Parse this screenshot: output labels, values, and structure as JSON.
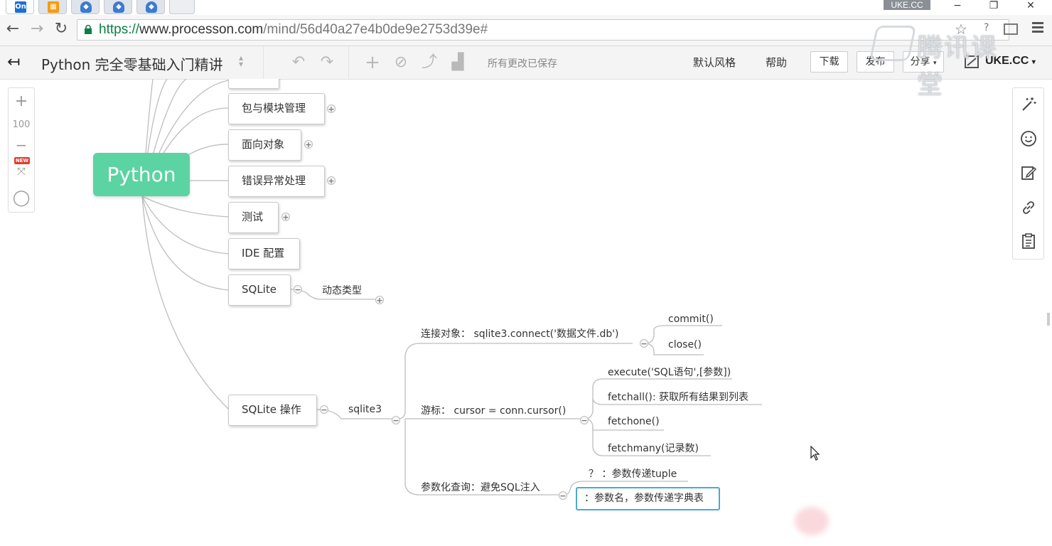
{
  "browser": {
    "tabs": [
      {
        "icon": "on-logo-icon",
        "active": true,
        "label": "On"
      },
      {
        "icon": "orange-app-icon",
        "active": false
      },
      {
        "icon": "shield-tab-icon",
        "active": false
      },
      {
        "icon": "shield-tab-icon",
        "active": false
      },
      {
        "icon": "shield-tab-icon",
        "active": false
      }
    ],
    "user_badge": "UKE.CC",
    "window_controls": {
      "minimize": "−",
      "restore": "❐",
      "close": "✕"
    },
    "url_secure": "https://",
    "url_host": "www.processon.com",
    "url_path": "/mind/56d40a27e4b0de9e2753d39e#",
    "watermark_text": "腾讯课堂"
  },
  "toolbar": {
    "doc_title": "Python 完全零基础入门精讲",
    "status": "所有更改已保存",
    "links": {
      "style": "默认风格",
      "help": "帮助"
    },
    "buttons": {
      "download": "下载",
      "publish": "发布",
      "share": "分享"
    },
    "username": "UKE.CC"
  },
  "zoom": {
    "level": "100",
    "new_badge": "NEW"
  },
  "mindmap": {
    "root": "Python",
    "branches": [
      {
        "label": "包与模块管理"
      },
      {
        "label": "面向对象"
      },
      {
        "label": "错误异常处理"
      },
      {
        "label": "测试"
      },
      {
        "label": "IDE 配置"
      },
      {
        "label": "SQLite"
      },
      {
        "label": "SQLite 操作"
      }
    ],
    "sqlite_child": "动态类型",
    "sqlite_ops": {
      "module": "sqlite3",
      "connect": {
        "label": "连接对象：  sqlite3.connect('数据文件.db')",
        "children": [
          "commit()",
          "close()"
        ]
      },
      "cursor": {
        "label": "游标：  cursor = conn.cursor()",
        "children": [
          "execute('SQL语句',[参数])",
          "fetchall(): 获取所有结果到列表",
          "fetchone()",
          "fetchmany(记录数)"
        ]
      },
      "param": {
        "label": "参数化查询：避免SQL注入",
        "children": [
          "？ ：参数传递tuple",
          "：参数名，参数传递字典表"
        ]
      }
    }
  }
}
